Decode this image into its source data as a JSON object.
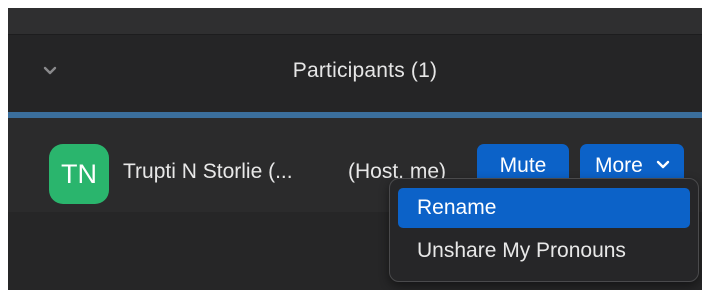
{
  "panel": {
    "title": "Participants (1)"
  },
  "participant": {
    "initials": "TN",
    "avatar_color": "#2ab56d",
    "name": "Trupti N Storlie (...",
    "role": "(Host, me)",
    "mute_label": "Mute",
    "more_label": "More"
  },
  "more_menu": {
    "items": [
      {
        "label": "Rename",
        "highlighted": true
      },
      {
        "label": "Unshare My Pronouns",
        "highlighted": false
      }
    ]
  },
  "colors": {
    "accent_blue": "#0c62c8",
    "divider_blue": "#3b6f9d",
    "panel_bg": "#2b2b2c"
  },
  "icons": {
    "collapse": "chevron-down-icon",
    "more_caret": "caret-down-icon"
  }
}
